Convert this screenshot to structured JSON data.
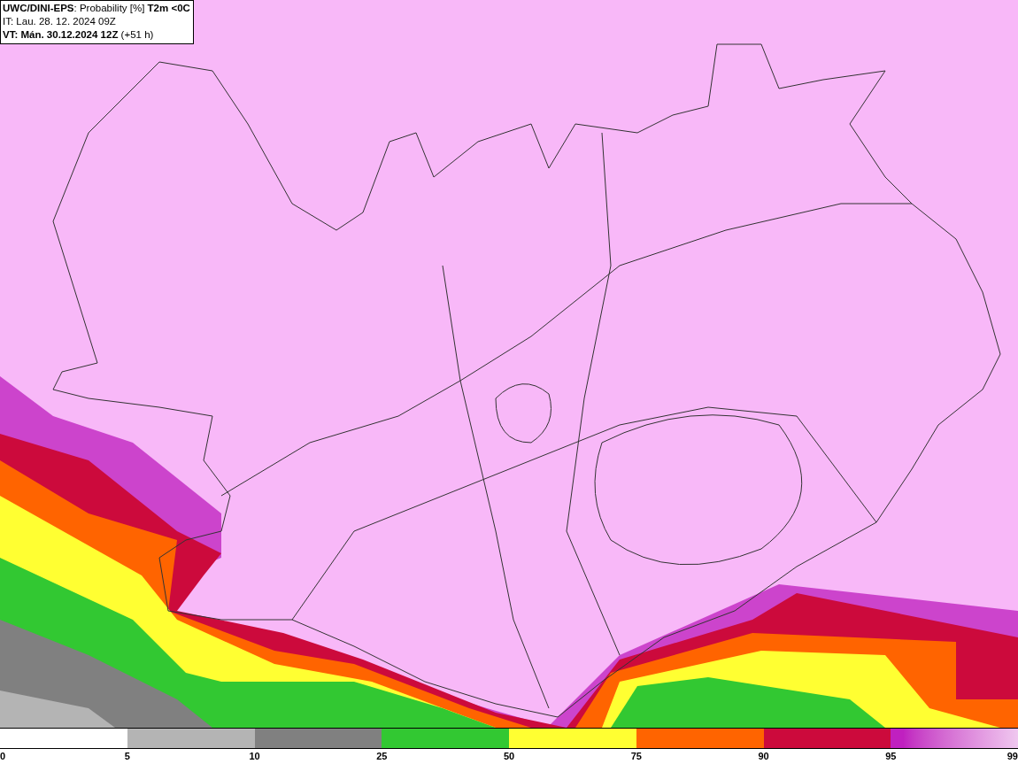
{
  "header": {
    "title": "**UWC/DINI-EPS**: Probability [%] **T2m <0C**",
    "initial_time": "IT: Lau. 28. 12. 2024 09Z",
    "valid_time": "**VT: Mán. 30.12.2024 12Z** (+51 h)"
  },
  "legend": {
    "segments": [
      {
        "kind": "solid",
        "color": "#b4b4b4"
      },
      {
        "kind": "solid",
        "color": "#808080"
      },
      {
        "kind": "solid",
        "color": "#32c832"
      },
      {
        "kind": "solid",
        "color": "#ffff32"
      },
      {
        "kind": "solid",
        "color": "#ff6400"
      },
      {
        "kind": "solid",
        "color": "#cc0a3c"
      },
      {
        "kind": "gradient",
        "color": "#c020c0"
      }
    ],
    "ticks": [
      "0",
      "5",
      "10",
      "25",
      "50",
      "75",
      "90",
      "95",
      "99"
    ]
  }
}
